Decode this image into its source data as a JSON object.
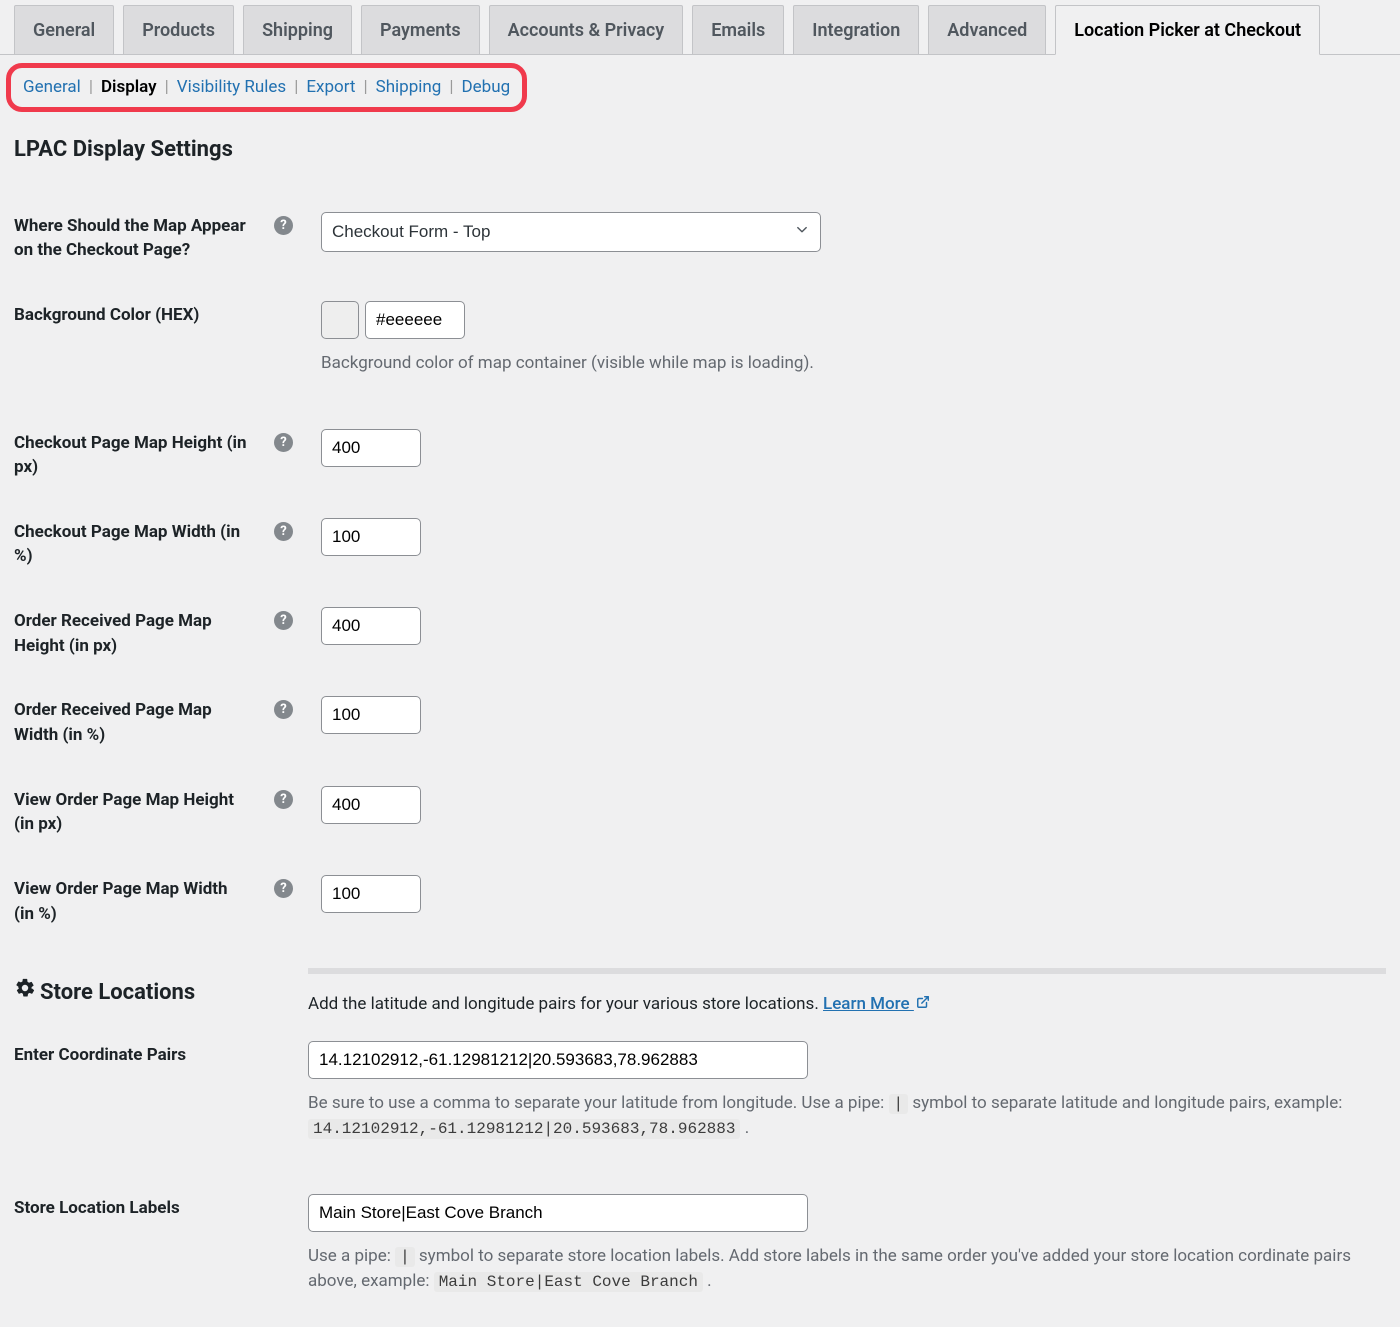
{
  "tabs": [
    {
      "label": "General",
      "active": false
    },
    {
      "label": "Products",
      "active": false
    },
    {
      "label": "Shipping",
      "active": false
    },
    {
      "label": "Payments",
      "active": false
    },
    {
      "label": "Accounts & Privacy",
      "active": false
    },
    {
      "label": "Emails",
      "active": false
    },
    {
      "label": "Integration",
      "active": false
    },
    {
      "label": "Advanced",
      "active": false
    },
    {
      "label": "Location Picker at Checkout",
      "active": true
    }
  ],
  "subnav": [
    {
      "label": "General",
      "active": false
    },
    {
      "label": "Display",
      "active": true
    },
    {
      "label": "Visibility Rules",
      "active": false
    },
    {
      "label": "Export",
      "active": false
    },
    {
      "label": "Shipping",
      "active": false
    },
    {
      "label": "Debug",
      "active": false
    }
  ],
  "section_title": "LPAC Display Settings",
  "fields": {
    "map_position": {
      "label": "Where Should the Map Appear on the Checkout Page?",
      "selected": "Checkout Form - Top"
    },
    "bg_color": {
      "label": "Background Color (HEX)",
      "value": "#eeeeee",
      "swatch_color": "#eeeeee",
      "desc": "Background color of map container (visible while map is loading)."
    },
    "checkout_height": {
      "label": "Checkout Page Map Height (in px)",
      "value": "400"
    },
    "checkout_width": {
      "label": "Checkout Page Map Width (in %)",
      "value": "100"
    },
    "order_received_height": {
      "label": "Order Received Page Map Height (in px)",
      "value": "400"
    },
    "order_received_width": {
      "label": "Order Received Page Map Width (in %)",
      "value": "100"
    },
    "view_order_height": {
      "label": "View Order Page Map Height (in px)",
      "value": "400"
    },
    "view_order_width": {
      "label": "View Order Page Map Width (in %)",
      "value": "100"
    }
  },
  "store_locations": {
    "title": "Store Locations",
    "intro": "Add the latitude and longitude pairs for your various store locations. ",
    "learn_more": "Learn More ",
    "coord_pairs": {
      "label": "Enter Coordinate Pairs",
      "value": "14.12102912,-61.12981212|20.593683,78.962883",
      "desc1": "Be sure to use a comma to separate your latitude from longitude. Use a pipe: ",
      "pipe": "|",
      "desc2": " symbol to separate latitude and longitude pairs, example: ",
      "example": "14.12102912,-61.12981212|20.593683,78.962883",
      "desc3": " ."
    },
    "labels": {
      "label": "Store Location Labels",
      "value": "Main Store|East Cove Branch",
      "desc1": "Use a pipe: ",
      "pipe": "|",
      "desc2": " symbol to separate store location labels. Add store labels in the same order you've added your store location cordinate pairs above, example: ",
      "example": "Main Store|East Cove Branch",
      "desc3": " ."
    }
  }
}
